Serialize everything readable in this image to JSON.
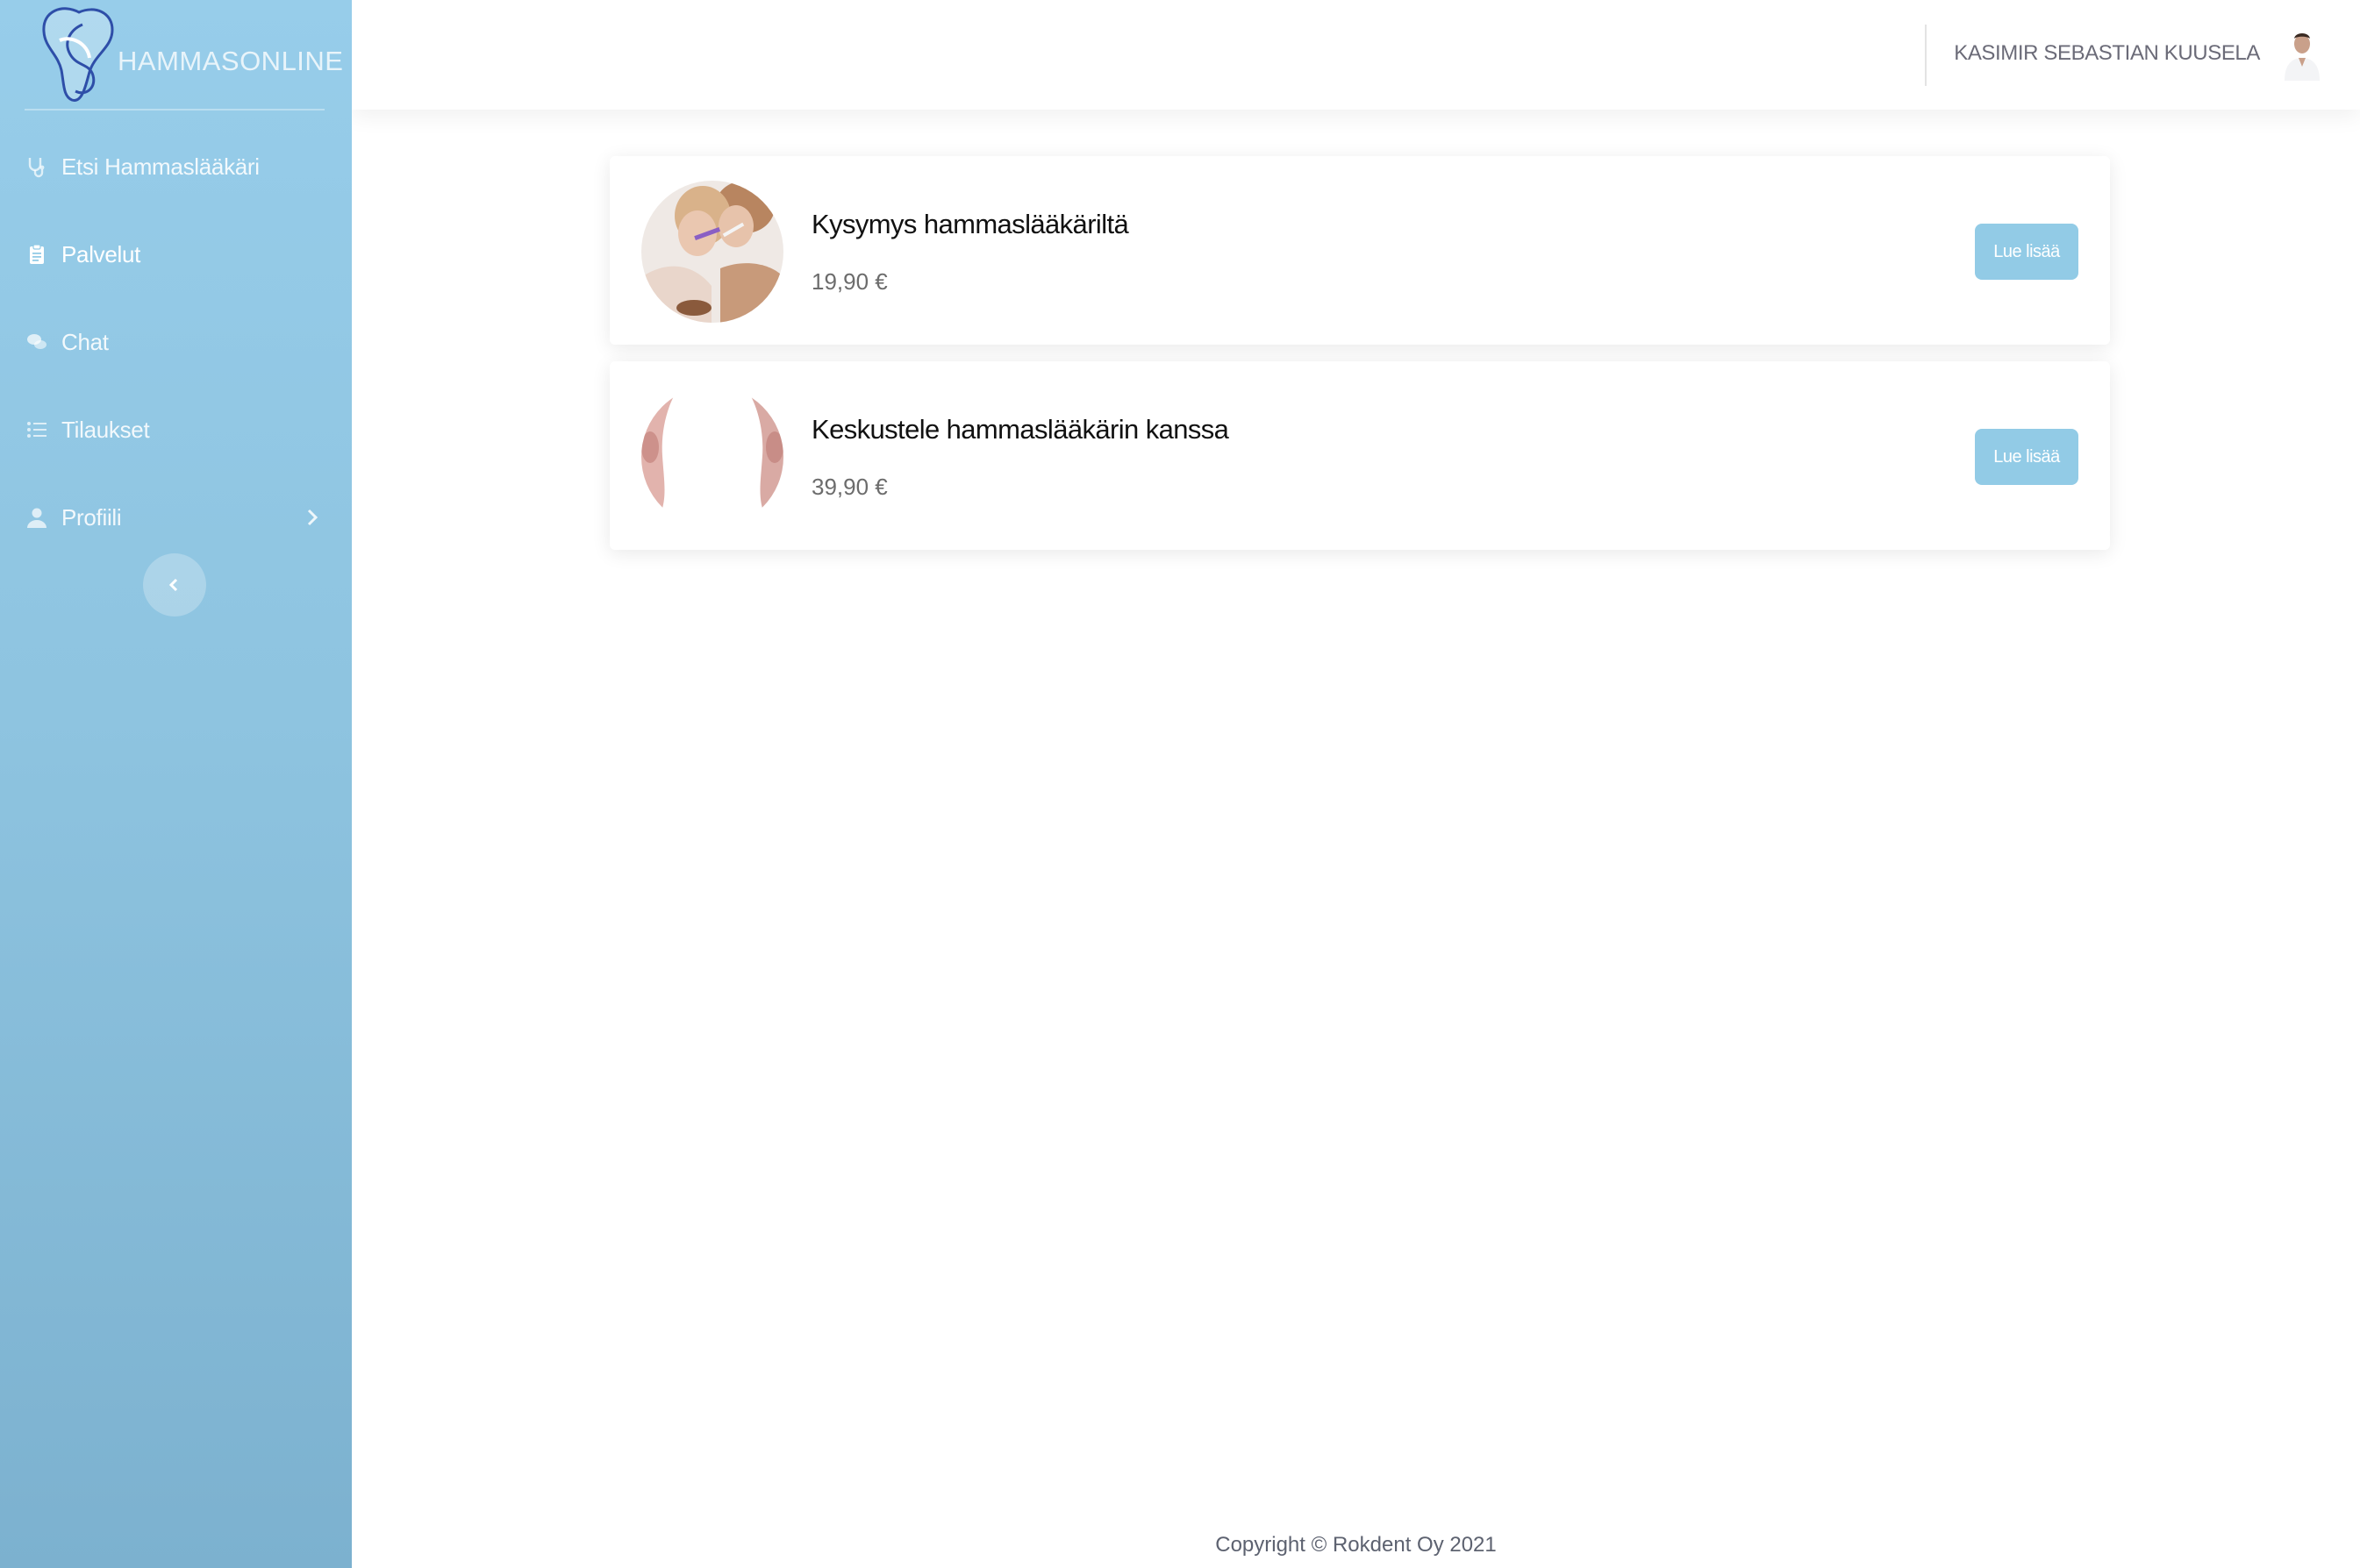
{
  "brand": {
    "name": "HAMMASONLINE"
  },
  "sidebar": {
    "items": [
      {
        "label": "Etsi Hammaslääkäri",
        "icon": "stethoscope-icon"
      },
      {
        "label": "Palvelut",
        "icon": "clipboard-icon"
      },
      {
        "label": "Chat",
        "icon": "chat-icon"
      },
      {
        "label": "Tilaukset",
        "icon": "list-icon"
      },
      {
        "label": "Profiili",
        "icon": "user-icon"
      }
    ],
    "active": "Palvelut"
  },
  "header": {
    "user_name": "KASIMIR SEBASTIAN KUUSELA"
  },
  "services": [
    {
      "title": "Kysymys hammaslääkäriltä",
      "price": "19,90 €",
      "button": "Lue lisää"
    },
    {
      "title": "Keskustele hammaslääkärin kanssa",
      "price": "39,90 €",
      "button": "Lue lisää"
    }
  ],
  "footer": {
    "copyright": "Copyright © Rokdent Oy 2021"
  },
  "colors": {
    "sidebar_top": "#97cdea",
    "sidebar_bottom": "#7cb1cf",
    "button": "#92cbe6"
  }
}
